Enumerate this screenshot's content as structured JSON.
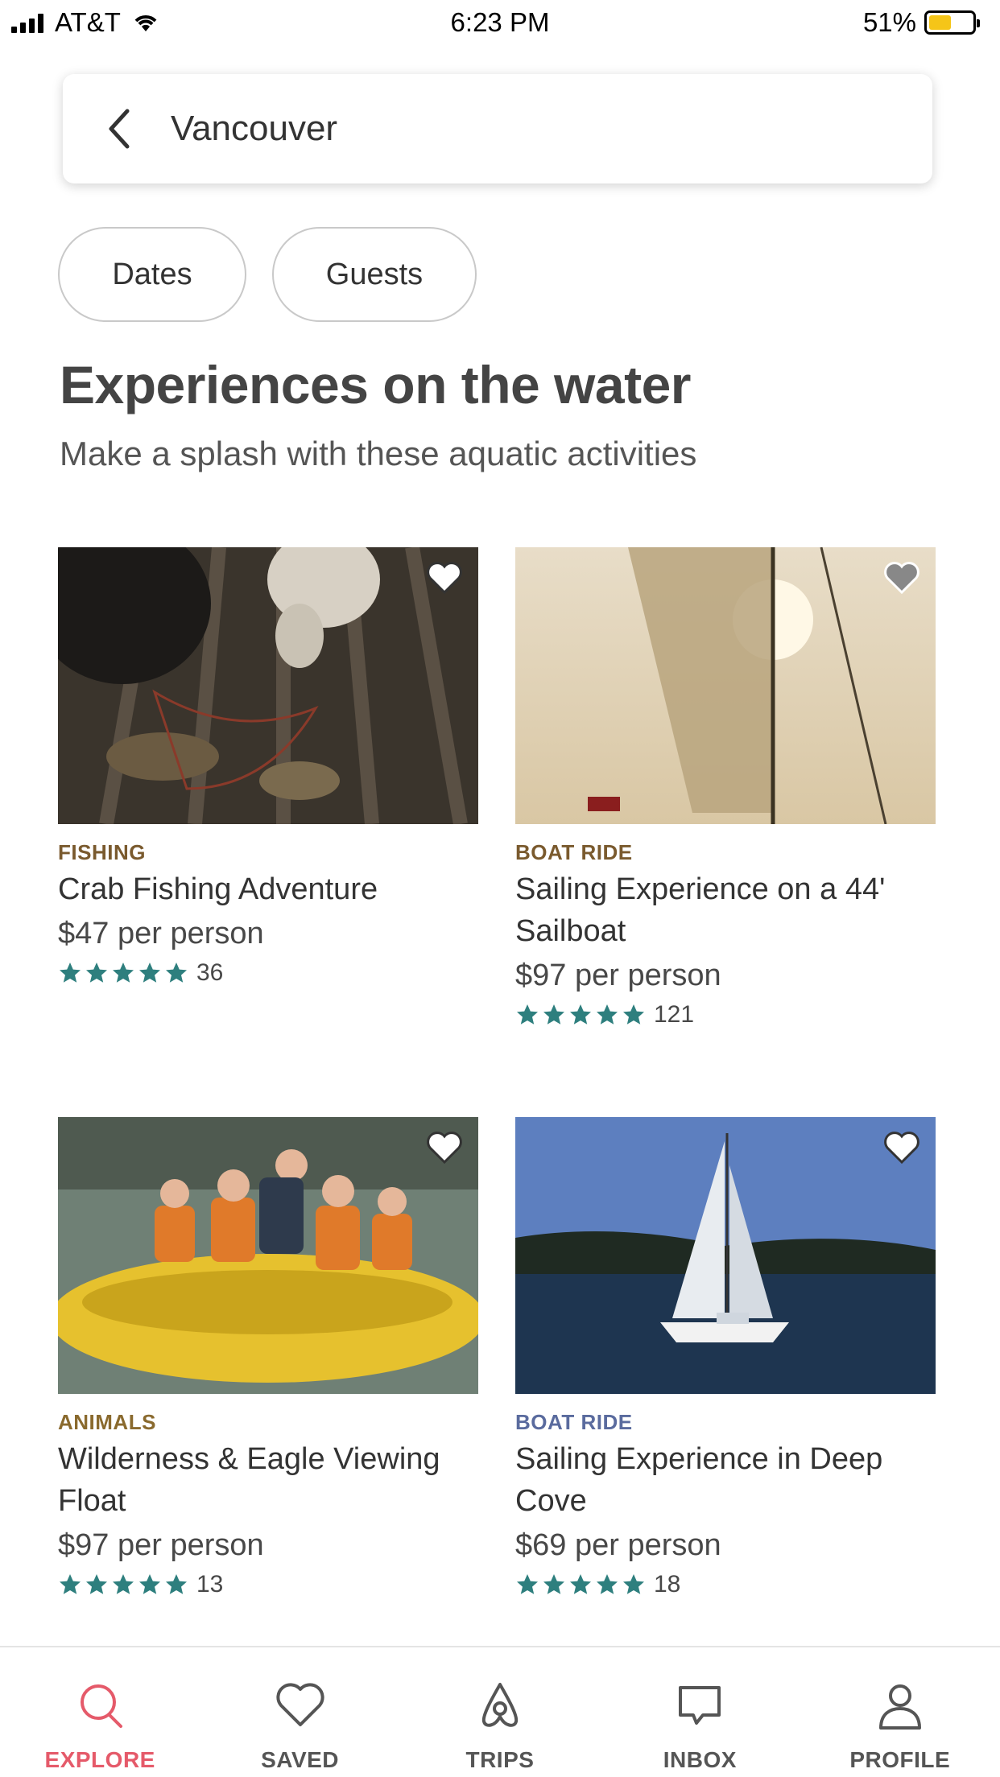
{
  "status_bar": {
    "carrier": "AT&T",
    "time": "6:23 PM",
    "battery": "51%",
    "battery_level": 0.51
  },
  "search": {
    "value": "Vancouver",
    "back_icon": "chevron-left-icon"
  },
  "filters": {
    "dates_label": "Dates",
    "guests_label": "Guests"
  },
  "section": {
    "title": "Experiences on the water",
    "subtitle": "Make a splash with these aquatic activities"
  },
  "cards": [
    {
      "category": "FISHING",
      "title": "Crab Fishing Adventure",
      "price": "$47 per person",
      "rating_count": "36",
      "stars": 5
    },
    {
      "category": "BOAT RIDE",
      "title": "Sailing Experience on a 44' Sailboat",
      "price": "$97 per person",
      "rating_count": "121",
      "stars": 5
    },
    {
      "category": "ANIMALS",
      "title": "Wilderness & Eagle Viewing Float",
      "price": "$97 per person",
      "rating_count": "13",
      "stars": 5
    },
    {
      "category": "BOAT RIDE",
      "title": "Sailing Experience in Deep Cove",
      "price": "$69 per person",
      "rating_count": "18",
      "stars": 5
    }
  ],
  "tabs": [
    {
      "label": "EXPLORE",
      "icon": "search-icon",
      "active": true
    },
    {
      "label": "SAVED",
      "icon": "heart-icon",
      "active": false
    },
    {
      "label": "TRIPS",
      "icon": "airbnb-logo-icon",
      "active": false
    },
    {
      "label": "INBOX",
      "icon": "chat-bubble-icon",
      "active": false
    },
    {
      "label": "PROFILE",
      "icon": "user-icon",
      "active": false
    }
  ],
  "colors": {
    "accent": "#e55a6a",
    "star": "#2e7f7e",
    "category_brown": "#7a5a2e",
    "category_blue": "#5a6b9e"
  }
}
